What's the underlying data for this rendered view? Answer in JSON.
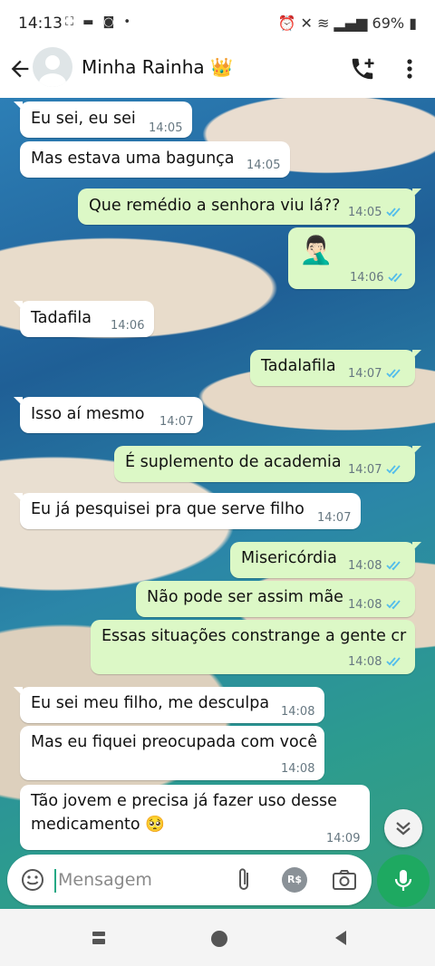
{
  "status_bar": {
    "time": "14:13",
    "battery": "69%"
  },
  "header": {
    "contact_name": "Minha Rainha",
    "contact_emoji": "👑"
  },
  "messages": [
    {
      "direction": "in",
      "text": "Eu sei, eu sei",
      "time": "14:05"
    },
    {
      "direction": "in",
      "text": "Mas estava uma bagunça",
      "time": "14:05"
    },
    {
      "direction": "out",
      "text": "Que remédio a senhora viu lá??",
      "time": "14:05",
      "status": "read"
    },
    {
      "direction": "out",
      "text": "",
      "sticker": "🤦🏻‍♂️",
      "time": "14:06",
      "status": "read"
    },
    {
      "direction": "in",
      "text": "Tadafila",
      "time": "14:06"
    },
    {
      "direction": "out",
      "text": "Tadalafila",
      "time": "14:07",
      "status": "read"
    },
    {
      "direction": "in",
      "text": "Isso aí mesmo",
      "time": "14:07"
    },
    {
      "direction": "out",
      "text": "É suplemento de academia",
      "time": "14:07",
      "status": "read"
    },
    {
      "direction": "in",
      "text": "Eu já pesquisei pra que serve filho",
      "time": "14:07"
    },
    {
      "direction": "out",
      "text": "Misericórdia",
      "time": "14:08",
      "status": "read"
    },
    {
      "direction": "out",
      "text": "Não pode ser assim mãe",
      "time": "14:08",
      "status": "read"
    },
    {
      "direction": "out",
      "text": "Essas situações constrange a gente cr",
      "time": "14:08",
      "status": "read"
    },
    {
      "direction": "in",
      "text": "Eu sei meu filho, me desculpa",
      "time": "14:08"
    },
    {
      "direction": "in",
      "text": "Mas eu fiquei preocupada com você",
      "time": "14:08"
    },
    {
      "direction": "in",
      "text": "Tão jovem e precisa já fazer uso desse",
      "text2": "medicamento 🥺",
      "time": "14:09"
    }
  ],
  "composer": {
    "placeholder": "Mensagem",
    "pay_label": "R$"
  },
  "colors": {
    "incoming": "#ffffff",
    "outgoing": "#dcf8c6",
    "read_tick": "#53bdeb",
    "mic": "#1ea961"
  },
  "icons": [
    "back-arrow-icon",
    "add-call-icon",
    "more-vert-icon",
    "emoji-icon",
    "attach-icon",
    "pay-icon",
    "camera-icon",
    "mic-icon",
    "scroll-down-icon"
  ]
}
